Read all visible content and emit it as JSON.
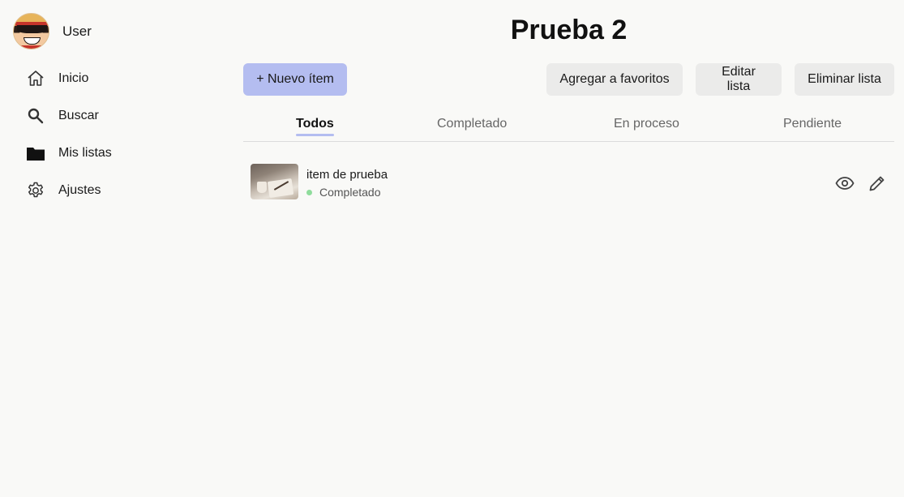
{
  "user": {
    "name": "User"
  },
  "nav": [
    {
      "label": "Inicio",
      "icon": "home-icon"
    },
    {
      "label": "Buscar",
      "icon": "search-icon"
    },
    {
      "label": "Mis listas",
      "icon": "folder-icon"
    },
    {
      "label": "Ajustes",
      "icon": "gear-icon"
    }
  ],
  "page": {
    "title": "Prueba 2"
  },
  "toolbar": {
    "new_item": "+ Nuevo ítem",
    "add_favorites": "Agregar a favoritos",
    "edit_list": "Editar lista",
    "delete_list": "Eliminar lista"
  },
  "tabs": [
    {
      "label": "Todos",
      "active": true
    },
    {
      "label": "Completado",
      "active": false
    },
    {
      "label": "En proceso",
      "active": false
    },
    {
      "label": "Pendiente",
      "active": false
    }
  ],
  "items": [
    {
      "name": "item de prueba",
      "status": "Completado",
      "status_color": "#8fdc9c",
      "actions": [
        "eye-icon",
        "pencil-icon"
      ]
    }
  ],
  "colors": {
    "accent": "#b4bdf0",
    "background": "#f9f9f7",
    "button_bg": "#ebebea"
  }
}
